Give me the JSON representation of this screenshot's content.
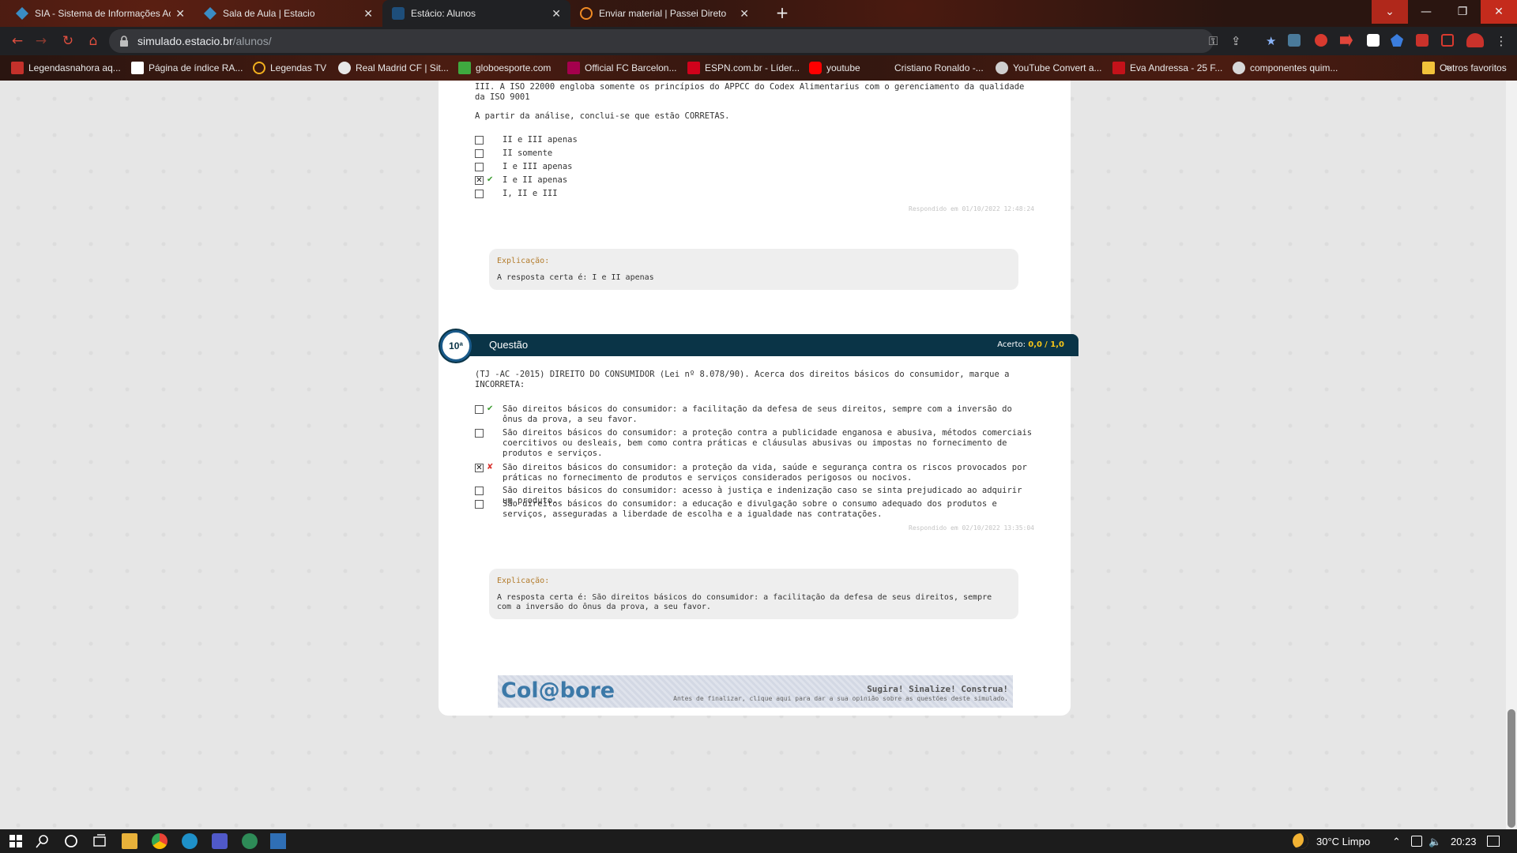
{
  "browser": {
    "tabs": [
      {
        "title": "SIA - Sistema de Informações Ac",
        "icon": "sia-icon",
        "active": false
      },
      {
        "title": "Sala de Aula | Estacio",
        "icon": "sia-icon",
        "active": false
      },
      {
        "title": "Estácio: Alunos",
        "icon": "estacio-icon",
        "active": true
      },
      {
        "title": "Enviar material | Passei Direto",
        "icon": "passei-direto-icon",
        "active": false
      }
    ],
    "url_host": "simulado.estacio.br",
    "url_path": "/alunos/",
    "bookmarks": [
      "Legendasnahora aq...",
      "Página de índice RA...",
      "Legendas TV",
      "Real Madrid CF | Sit...",
      "globoesporte.com",
      "Official FC Barcelon...",
      "ESPN.com.br - Líder...",
      "youtube",
      "Cristiano Ronaldo -...",
      "YouTube Convert a...",
      "Eva Andressa - 25 F...",
      "componentes quim..."
    ],
    "bookmarks_overflow": "»",
    "other_bookmarks": "Outros favoritos"
  },
  "q9": {
    "statement_tail": "III. A ISO 22000 engloba somente os princípios do APPCC do Codex Alimentarius com o gerenciamento da qualidade da ISO 9001",
    "conclusion": "A partir da análise, conclui-se que estão CORRETAS.",
    "options": [
      {
        "label": "II e III apenas",
        "checked": false,
        "mark": ""
      },
      {
        "label": "II somente",
        "checked": false,
        "mark": ""
      },
      {
        "label": "I e III apenas",
        "checked": false,
        "mark": ""
      },
      {
        "label": "I e II apenas",
        "checked": true,
        "mark": "correct"
      },
      {
        "label": "I, II e III",
        "checked": false,
        "mark": ""
      }
    ],
    "answered_at": "Respondido em 01/10/2022 12:48:24",
    "explanation_title": "Explicação:",
    "explanation_body": "A resposta certa é: I e II apenas"
  },
  "q10": {
    "number": "10ª",
    "title": "Questão",
    "score_label": "Acerto:",
    "score_value": "0,0",
    "score_total": "/ 1,0",
    "statement": "(TJ -AC -2015) DIREITO DO CONSUMIDOR (Lei nº 8.078/90). Acerca dos direitos básicos do consumidor, marque a INCORRETA:",
    "options": [
      {
        "label": "São direitos básicos do consumidor: a facilitação da defesa de seus direitos, sempre com a inversão do ônus da prova, a seu favor.",
        "checked": false,
        "mark": "correct"
      },
      {
        "label": "São direitos básicos do consumidor: a proteção contra a publicidade enganosa e abusiva, métodos comerciais coercitivos ou desleais, bem como contra práticas e cláusulas abusivas ou impostas no fornecimento de produtos e serviços.",
        "checked": false,
        "mark": ""
      },
      {
        "label": "São direitos básicos do consumidor: a proteção da vida, saúde e segurança contra os riscos provocados por práticas no fornecimento de produtos e serviços considerados perigosos ou nocivos.",
        "checked": true,
        "mark": "wrong"
      },
      {
        "label": "São direitos básicos do consumidor: acesso à justiça e indenização caso se sinta prejudicado ao adquirir um produto.",
        "checked": false,
        "mark": ""
      },
      {
        "label": "São direitos básicos do consumidor: a educação e divulgação sobre o consumo adequado dos produtos e serviços, asseguradas a liberdade de escolha e a igualdade nas contratações.",
        "checked": false,
        "mark": ""
      }
    ],
    "answered_at": "Respondido em 02/10/2022 13:35:04",
    "explanation_title": "Explicação:",
    "explanation_body": "A resposta certa é: São direitos básicos do consumidor: a facilitação da defesa de seus direitos, sempre com a inversão do ônus da prova, a seu favor."
  },
  "colabore": {
    "logo": "Col@bore",
    "slogan": "Sugira! Sinalize! Construa!",
    "note": "Antes de finalizar, clique aqui para dar a sua opinião sobre as questões deste simulado."
  },
  "taskbar": {
    "weather": "30°C  Limpo",
    "time": "20:23"
  },
  "colors": {
    "question_header": "#0a3447",
    "score_value": "#f5c518",
    "correct_mark": "#3b9b2e",
    "wrong_mark": "#d9332f"
  }
}
